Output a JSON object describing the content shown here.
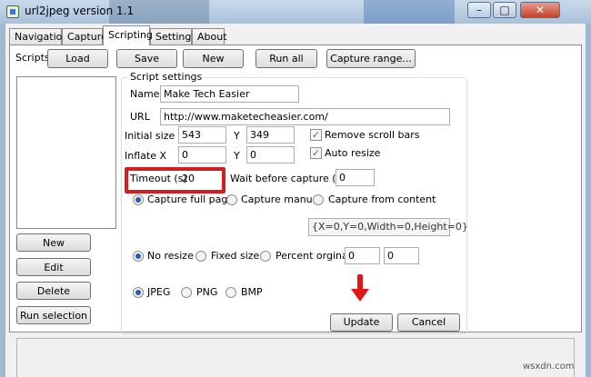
{
  "window": {
    "title": "url2jpeg version 1.1",
    "minimize": "–",
    "maximize": "□",
    "close": "✕"
  },
  "tabs": [
    {
      "label": "Navigation",
      "active": false
    },
    {
      "label": "Capture",
      "active": false
    },
    {
      "label": "Scripting",
      "active": true
    },
    {
      "label": "Settings",
      "active": false
    },
    {
      "label": "About",
      "active": false
    }
  ],
  "toolbar": {
    "scripts_label": "Scripts",
    "load": "Load",
    "save": "Save",
    "new": "New",
    "run_all": "Run all",
    "capture_range": "Capture range..."
  },
  "left_buttons": {
    "new": "New",
    "edit": "Edit",
    "delete": "Delete",
    "run_selection": "Run selection"
  },
  "script_settings": {
    "group_title": "Script settings",
    "name_label": "Name",
    "name_value": "Make Tech Easier",
    "url_label": "URL",
    "url_value": "http://www.maketecheasier.com/",
    "initial_size_label": "Initial size X",
    "initial_x": "543",
    "initial_y_label": "Y",
    "initial_y": "349",
    "inflate_label": "Inflate X",
    "inflate_x": "0",
    "inflate_y_label": "Y",
    "inflate_y": "0",
    "remove_scroll_bars": "Remove scroll bars",
    "remove_scroll_bars_checked": true,
    "auto_resize": "Auto resize",
    "auto_resize_checked": true,
    "timeout_label": "Timeout (s)",
    "timeout_value": "20",
    "wait_label": "Wait before capture (ms)",
    "wait_value": "0",
    "capture_options": [
      "Capture full page",
      "Capture manual",
      "Capture from content"
    ],
    "capture_selected": "Capture full page",
    "region_value": "{X=0,Y=0,Width=0,Height=0}",
    "resize_options": [
      "No resize",
      "Fixed size",
      "Percent orginal"
    ],
    "resize_selected": "No resize",
    "percent_a": "0",
    "percent_b": "0",
    "format_options": [
      "JPEG",
      "PNG",
      "BMP"
    ],
    "format_selected": "JPEG",
    "update": "Update",
    "cancel": "Cancel"
  },
  "watermark": "wsxdn.com",
  "colors": {
    "highlight_box": "#d21e1e",
    "arrow": "#e21616"
  }
}
